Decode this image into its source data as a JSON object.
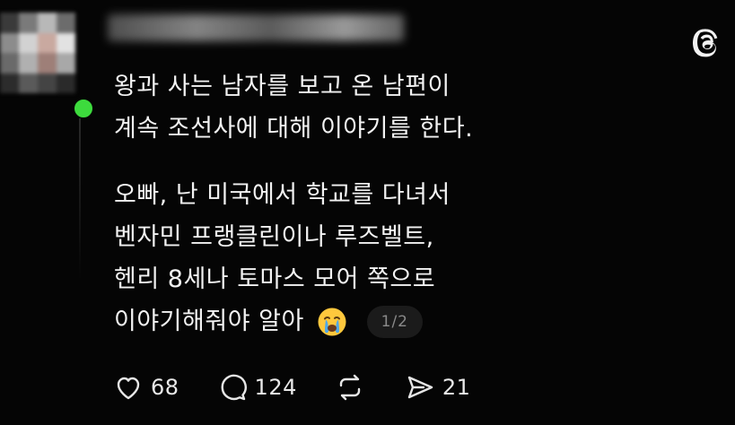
{
  "post": {
    "paragraph1": [
      "왕과 사는 남자를 보고 온 남편이",
      "계속 조선사에 대해 이야기를 한다."
    ],
    "paragraph2": [
      "오빠, 난 미국에서 학교를 다녀서",
      "벤자민 프랭클린이나 루즈벨트,",
      "헨리 8세나 토마스 모어 쪽으로"
    ],
    "last_line": "이야기해줘야 알아",
    "emoji": "crying-face-emoji",
    "page_indicator": "1/2"
  },
  "actions": {
    "likes": "68",
    "replies": "124",
    "reposts": "",
    "shares": "21"
  },
  "icons": {
    "like": "heart-icon",
    "reply": "speech-bubble-icon",
    "repost": "repost-arrows-icon",
    "share": "send-icon",
    "logo": "threads-logo-icon"
  },
  "colors": {
    "background": "#050505",
    "text": "#f2f2f2",
    "online": "#3ddb3d",
    "badge": "#1b1b1b"
  }
}
